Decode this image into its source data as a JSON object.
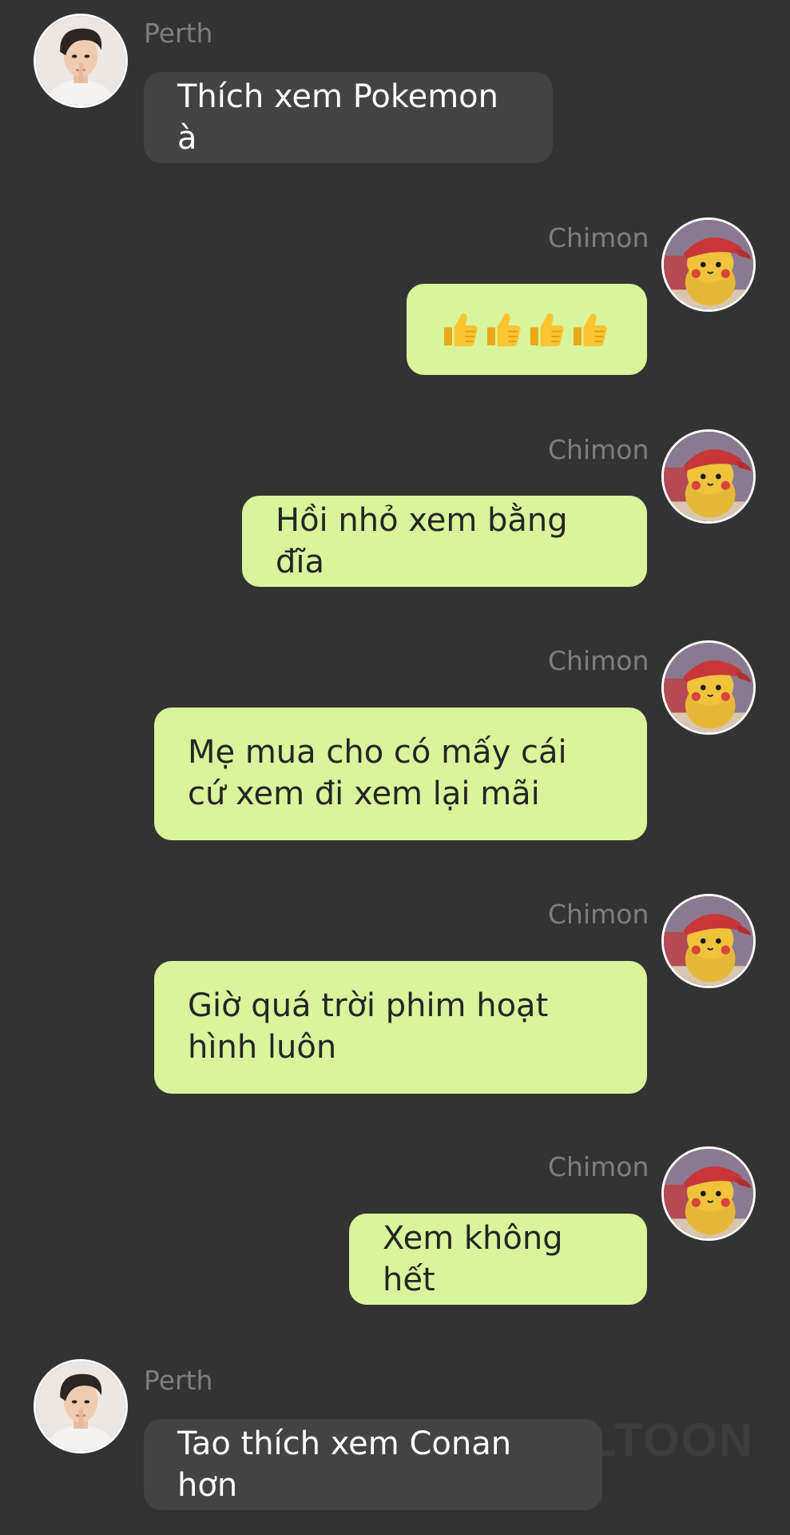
{
  "colors": {
    "background": "#333333",
    "left_bubble": "#434343",
    "right_bubble": "#d9f49b",
    "sender_name": "#7e7e7e"
  },
  "watermark": "LTOON",
  "messages": [
    {
      "sender": "Perth",
      "text": "Thích xem Pokemon à",
      "side": "left",
      "avatar_icon": "perth-avatar"
    },
    {
      "sender": "Chimon",
      "text": "👍👍👍👍",
      "side": "right",
      "avatar_icon": "pikachu-avatar"
    },
    {
      "sender": "Chimon",
      "text": "Hồi nhỏ xem bằng đĩa",
      "side": "right",
      "avatar_icon": "pikachu-avatar"
    },
    {
      "sender": "Chimon",
      "text": "Mẹ mua cho có mấy cái cứ xem đi xem lại mãi",
      "side": "right",
      "avatar_icon": "pikachu-avatar"
    },
    {
      "sender": "Chimon",
      "text": "Giờ quá trời phim hoạt hình luôn",
      "side": "right",
      "avatar_icon": "pikachu-avatar"
    },
    {
      "sender": "Chimon",
      "text": "Xem không hết",
      "side": "right",
      "avatar_icon": "pikachu-avatar"
    },
    {
      "sender": "Perth",
      "text": "Tao thích xem Conan hơn",
      "side": "left",
      "avatar_icon": "perth-avatar"
    }
  ]
}
